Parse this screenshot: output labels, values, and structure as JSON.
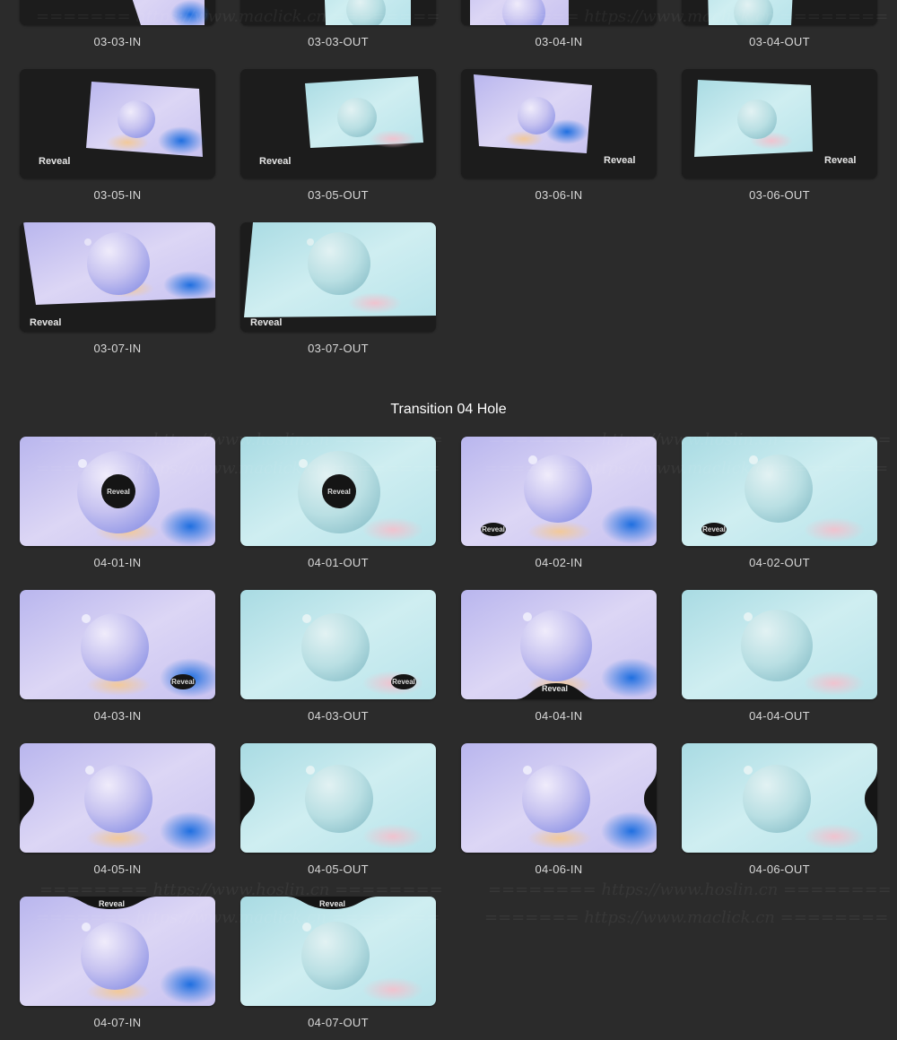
{
  "top_rows": {
    "row_a": [
      "03-03-IN",
      "03-03-OUT",
      "03-04-IN",
      "03-04-OUT"
    ],
    "row_b": [
      "03-05-IN",
      "03-05-OUT",
      "03-06-IN",
      "03-06-OUT"
    ],
    "row_c": [
      "03-07-IN",
      "03-07-OUT"
    ]
  },
  "reveal_word": "Reveal",
  "section_title": "Transition 04 Hole",
  "hole_rows": {
    "row_1": [
      "04-01-IN",
      "04-01-OUT",
      "04-02-IN",
      "04-02-OUT"
    ],
    "row_2": [
      "04-03-IN",
      "04-03-OUT",
      "04-04-IN",
      "04-04-OUT"
    ],
    "row_3": [
      "04-05-IN",
      "04-05-OUT",
      "04-06-IN",
      "04-06-OUT"
    ],
    "row_4": [
      "04-07-IN",
      "04-07-OUT"
    ]
  },
  "watermarks": {
    "a": "======== https://www.hoslin.cn ========",
    "b": "======= https://www.maclick.cn ========"
  },
  "colors": {
    "background": "#2b2b2b",
    "tile_dark": "#1a1a1a",
    "lavender": "#c9c6f2",
    "cyan": "#bfe7ee",
    "blue_accent": "#1f6fe0"
  }
}
